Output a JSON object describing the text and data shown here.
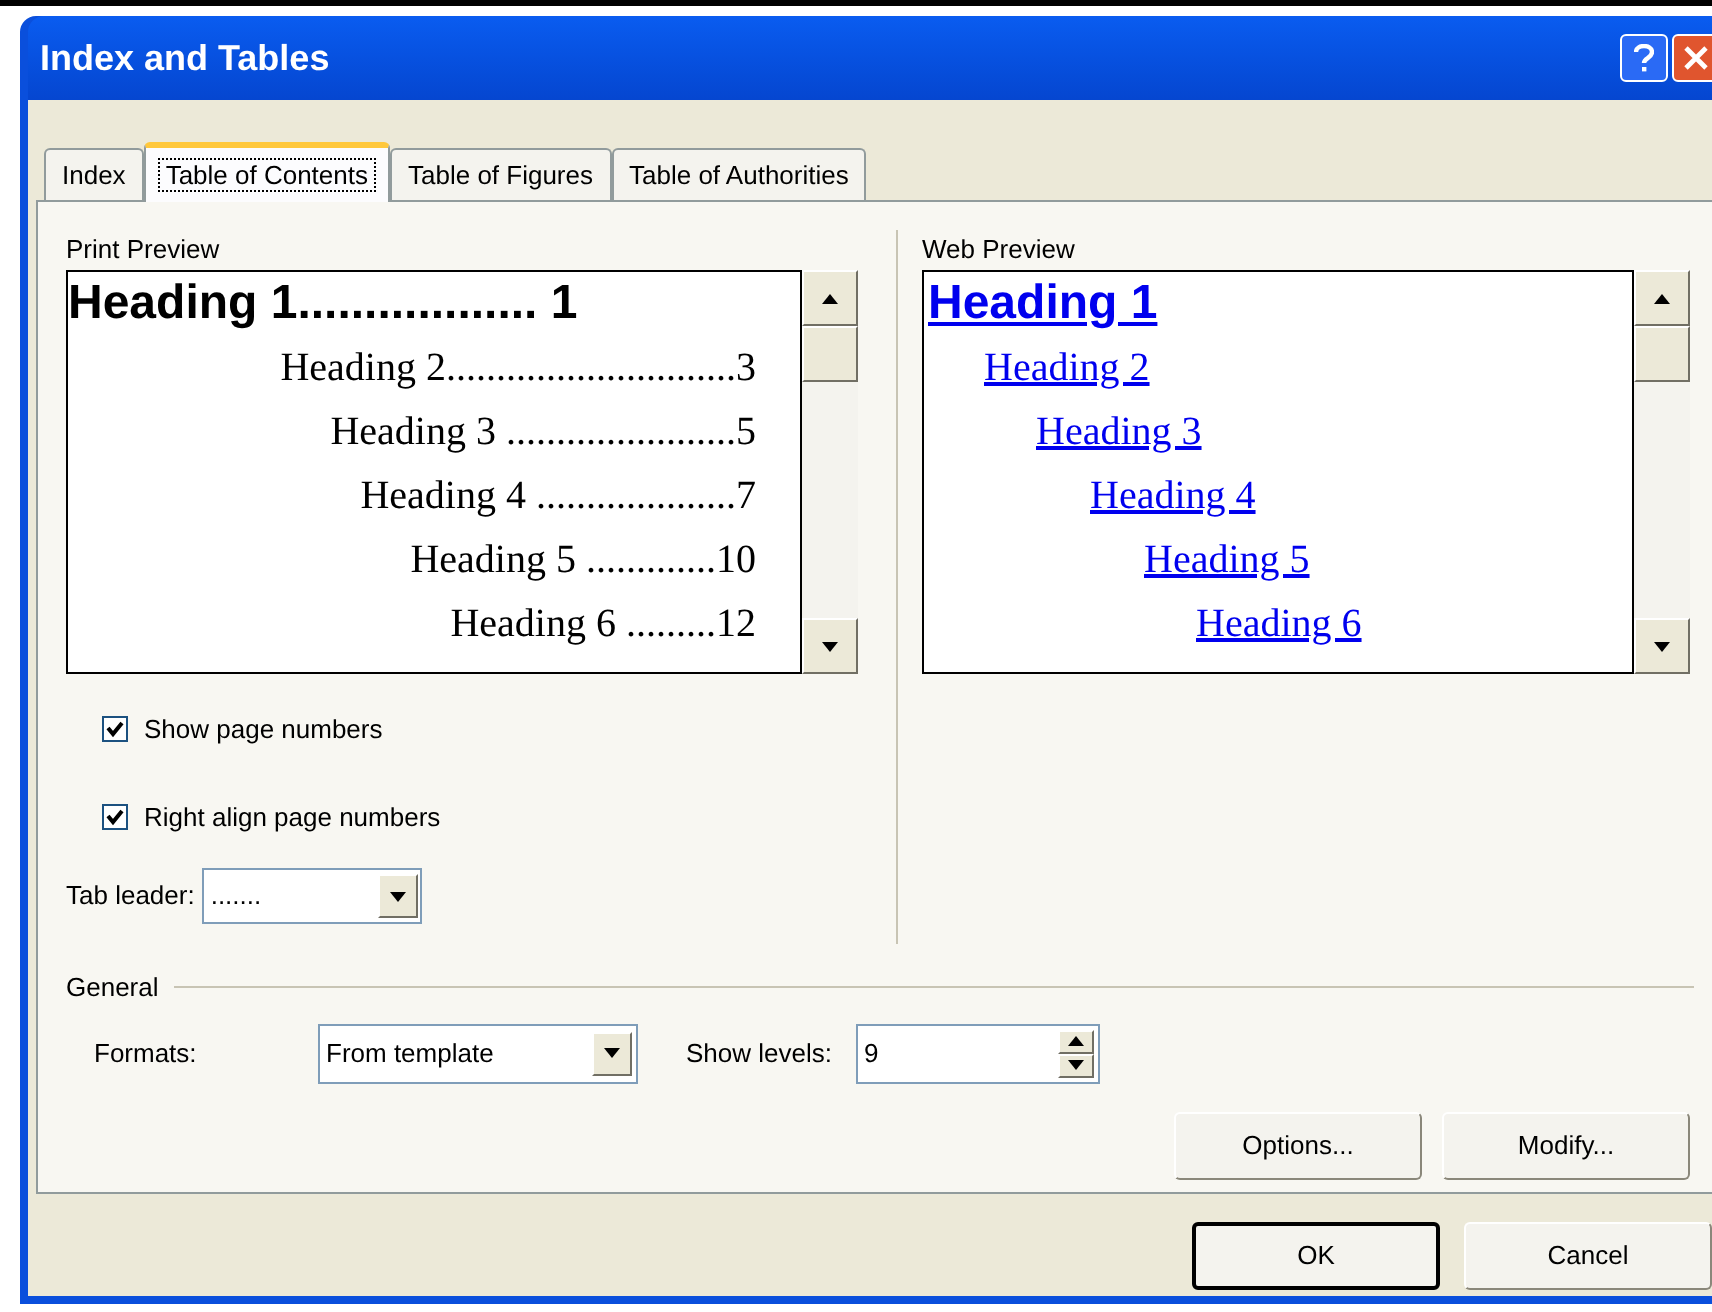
{
  "window": {
    "title": "Index and Tables"
  },
  "tabs": [
    {
      "label": "Index",
      "selected": false
    },
    {
      "label": "Table of Contents",
      "selected": true
    },
    {
      "label": "Table of Figures",
      "selected": false
    },
    {
      "label": "Table of Authorities",
      "selected": false
    }
  ],
  "print_preview": {
    "label": "Print Preview",
    "entries": [
      {
        "text": "Heading 1.................. 1",
        "children": [
          {
            "text": "Heading 2.............................3",
            "children": [
              {
                "text": "Heading 3 .......................5",
                "children": [
                  {
                    "text": "Heading 4 ....................7",
                    "children": [
                      {
                        "text": "Heading 5 .............10",
                        "children": [
                          {
                            "text": "Heading 6 .........12"
                          }
                        ]
                      }
                    ]
                  }
                ]
              }
            ]
          }
        ]
      }
    ]
  },
  "web_preview": {
    "label": "Web Preview",
    "entries": [
      {
        "text": "Heading 1",
        "children": [
          {
            "text": "Heading 2",
            "children": [
              {
                "text": "Heading 3",
                "children": [
                  {
                    "text": "Heading 4",
                    "children": [
                      {
                        "text": "Heading 5",
                        "children": [
                          {
                            "text": "Heading 6"
                          }
                        ]
                      }
                    ]
                  }
                ]
              }
            ]
          }
        ]
      }
    ]
  },
  "options": [
    {
      "label": "Show page numbers",
      "checked": true
    },
    {
      "label": "Right align page numbers",
      "checked": true
    }
  ],
  "tab_leader": {
    "label": "Tab leader:",
    "value": "......."
  },
  "general": {
    "label": "General",
    "formats": {
      "label": "Formats:",
      "value": "From template"
    },
    "show_levels": {
      "label": "Show levels:",
      "value": "9"
    }
  },
  "group_buttons": [
    {
      "label": "Options..."
    },
    {
      "label": "Modify..."
    }
  ],
  "buttons": [
    {
      "label": "OK",
      "default": true
    },
    {
      "label": "Cancel",
      "default": false
    }
  ]
}
